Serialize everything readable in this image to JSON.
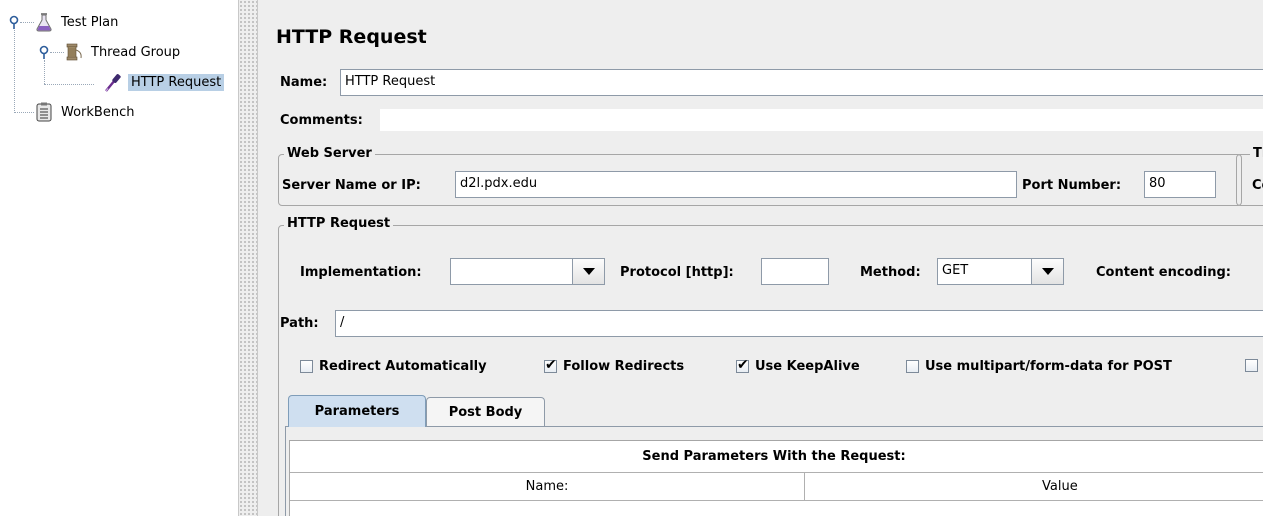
{
  "tree": {
    "items": [
      {
        "label": "Test Plan",
        "icon": "flask-icon"
      },
      {
        "label": "Thread Group",
        "icon": "spool-icon"
      },
      {
        "label": "HTTP Request",
        "icon": "pipette-icon",
        "selected": true
      },
      {
        "label": "WorkBench",
        "icon": "clipboard-icon"
      }
    ]
  },
  "panel": {
    "title": "HTTP Request",
    "name_label": "Name:",
    "name_value": "HTTP Request",
    "comments_label": "Comments:",
    "comments_value": ""
  },
  "web_server": {
    "legend": "Web Server",
    "server_label": "Server Name or IP:",
    "server_value": "d2l.pdx.edu",
    "port_label": "Port Number:",
    "port_value": "80",
    "timeouts_legend_partial": "Ti",
    "timeouts_label_partial": "Co"
  },
  "http_request": {
    "legend": "HTTP Request",
    "implementation_label": "Implementation:",
    "implementation_value": "",
    "protocol_label": "Protocol [http]:",
    "protocol_value": "",
    "method_label": "Method:",
    "method_value": "GET",
    "encoding_label": "Content encoding:",
    "path_label": "Path:",
    "path_value": "/"
  },
  "options": [
    {
      "label": "Redirect Automatically",
      "checked": false
    },
    {
      "label": "Follow Redirects",
      "checked": true
    },
    {
      "label": "Use KeepAlive",
      "checked": true
    },
    {
      "label": "Use multipart/form-data for POST",
      "checked": false
    }
  ],
  "tabs": [
    {
      "label": "Parameters",
      "active": true
    },
    {
      "label": "Post Body",
      "active": false
    }
  ],
  "params_table": {
    "caption": "Send Parameters With the Request:",
    "columns": [
      "Name:",
      "Value"
    ]
  },
  "checkmark": "✔",
  "colors": {
    "selection": "#b8cfe5",
    "panel_bg": "#eeeeee",
    "active_tab": "#cfdff0"
  }
}
